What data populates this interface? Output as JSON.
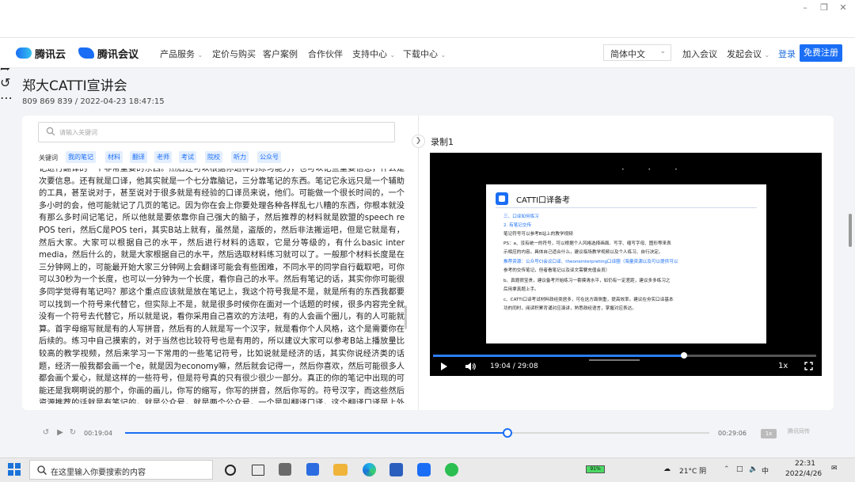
{
  "browser": {
    "icons": [
      "back-icon",
      "link-icon",
      "refresh-icon",
      "globe-icon",
      "share-icon",
      "extension-icon",
      "more-icon"
    ],
    "window_controls": [
      "minimize-icon",
      "restore-icon",
      "close-icon"
    ]
  },
  "site_nav": {
    "logo_cloud": "腾讯云",
    "logo_meeting": "腾讯会议",
    "items": [
      "产品服务",
      "定价与购买",
      "客户案例",
      "合作伙伴",
      "支持中心",
      "下载中心"
    ],
    "language": "简体中文",
    "join_meeting": "加入会议",
    "start_meeting": "发起会议",
    "login": "登录",
    "register": "免费注册"
  },
  "meeting": {
    "title": "郑大CATTI宣讲会",
    "meta": "809 869 839 / 2022-04-23 18:47:15"
  },
  "transcript_panel": {
    "search_placeholder": "请输入关键词",
    "keywords_label": "关键词",
    "keywords": [
      "我的笔记",
      "材料",
      "翻译",
      "老师",
      "考试",
      "院校",
      "听力",
      "公众号"
    ],
    "text": "记进行翻译的一个非常重要的东西。然后还可以根据你这样的练习能力，也可以记些重要信息，什么是次要信息。还有就是口译，他其实就是一个七分靠脑记，三分靠笔记的东西。笔记它永远只是一个辅助的工具，甚至说对于，甚至说对于很多就是有经验的口译员来说，他们。可能做一个很长时间的，一个多小时的会，他可能就记了几页的笔记。因为你在会上你要处理各种各样乱七八糟的东西，你根本就没有那么多时间记笔记，所以他就是要依靠你自己强大的脑子，然后推荐的材料就是欧盟的speech re POS teri，然后C是POS teri，其实B站上就有，虽然是，盗版的，然后非法搬运吧，但是它就是有，然后大家。大家可以根据自己的水平，然后进行材料的选取，它是分等级的，有什么basic inter media，然后什么的，就是大家根据自己的水平，然后选取材料练习就可以了。一般那个材料长度是在三分钟网上的，可能最开始大家三分钟网上会翻译可能会有些困难，不同水平的同学自行截取吧，可你可以30秒为一个长度，也可以一分钟为一个长度，看你自己的水平。然后有笔记的话，其实你你可能很多同学觉得有笔记吗？那这个重点应该就是放在笔记上，我这个符号我是不是，就是所有的东西我都要可以找到一个符号来代替它，但实际上不是，就是很多时候你在面对一个话题的时候，很多内容完全就没有一个符号去代替它，所以就是说，看你采用自己喜欢的方法吧，有的人会画个圈儿，有的人可能就算。首字母缩写就是有的人写拼音，然后有的人就是写一个汉字，就是看你个人风格，这个是需要你在后续的。练习中自己摸索的，对于当然也比较符号也是有用的，所以建议大家可以参考B站上播放量比较高的教学视频，然后来学习一下常用的一些笔记符号，比如说就是经济的话，其实你说经济类的话题，经济一般我都会画一个e，就是因为economy嘛，然后就会记得一，然后你喜欢，然后可能很多人都会画个爱心，就是这样的一些符号，但是符号真的只有很少很少一部分。真正的你的笔记中出现的可能还是我啊啊说的那个，你画的画儿，你写的缩写，你写的拼音，然后你写的。符号汉字，而这些然后资源推荐的话就是有笔记的，就是公众号，就是两个公众号，一个是叫翻译口译，这个翻译口译是上外的一个口译的学姐，不是上外口译上外，上外有一个口译专业的学姐，然后"
  },
  "video_panel": {
    "recording_label": "录制1",
    "slide_title": "CATTI口译备考",
    "slide_lines": [
      "三、口译如何练习",
      "2. 有笔记交传",
      "笔记符号可以参考B站上的教学视频",
      "PS：a、没有统一的符号，可以根据个人风格选择画面、写字、缩写字母、图形等来表",
      "示相应的内容。具体自己适合什么，建议临场教学视频以及个人练习、自行决定。",
      "推荐资源：公众号CI会议口译、theoneinterpreting口译圈（海量资源以及可以提供可以",
      "参考的交传笔记，但者看笔记以及译文需要充值会员）",
      "b、真题很宝贵，建议备考开始练习一套摸清水平，如仍有一定差距，建议多多练习之",
      "后用拿真题上手。",
      "c、CATTI口译考试材料政经类居多，可在这方面侧重，提高效率。建议在夯实口译基本",
      "功的同时，阅读积累背诵对应演讲，熟悉政经语言，掌握对应表达。"
    ],
    "current_time": "19:04",
    "duration": "29:08",
    "time_display": "19:04 / 29:08",
    "speed": "1x",
    "progress": 0.654
  },
  "audio_player": {
    "current_time": "00:19:04",
    "duration": "00:29:06",
    "progress": 0.655,
    "speed": "1x",
    "brand": "腾讯同传"
  },
  "taskbar": {
    "search_placeholder": "在这里输入你要搜索的内容",
    "battery": "91%",
    "weather": "21°C 阴",
    "ime": "中",
    "time": "22:31",
    "date": "2022/4/26"
  },
  "colors": {
    "accent": "#1a6ef5",
    "tag_bg": "#e3eeff",
    "video_bg": "#000000"
  }
}
